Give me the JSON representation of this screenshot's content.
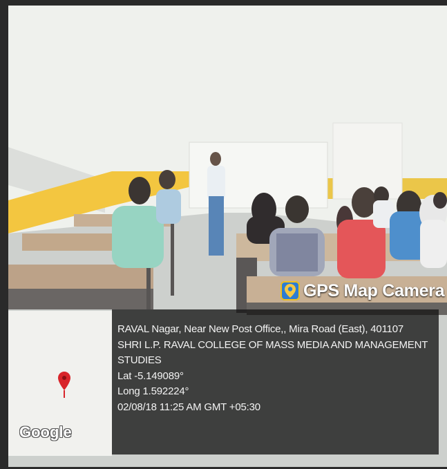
{
  "brand": {
    "app_icon": "map-pin-icon",
    "title": "GPS Map Camera"
  },
  "location": {
    "address": "RAVAL Nagar, Near New Post Office,, Mira Road (East), 401107",
    "place_line1": "SHRI L.P. RAVAL COLLEGE OF MASS MEDIA AND MANAGEMENT",
    "place_line2": "STUDIES",
    "lat": "Lat -5.149089°",
    "long": "Long 1.592224°",
    "datetime": "02/08/18 11:25 AM GMT +05:30"
  },
  "map": {
    "logo": "Google",
    "marker_icon": "map-marker-icon",
    "marker_color": "#d8242a"
  },
  "colors": {
    "wall_stripe": "#f2c230",
    "overlay_bg": "#161616"
  }
}
